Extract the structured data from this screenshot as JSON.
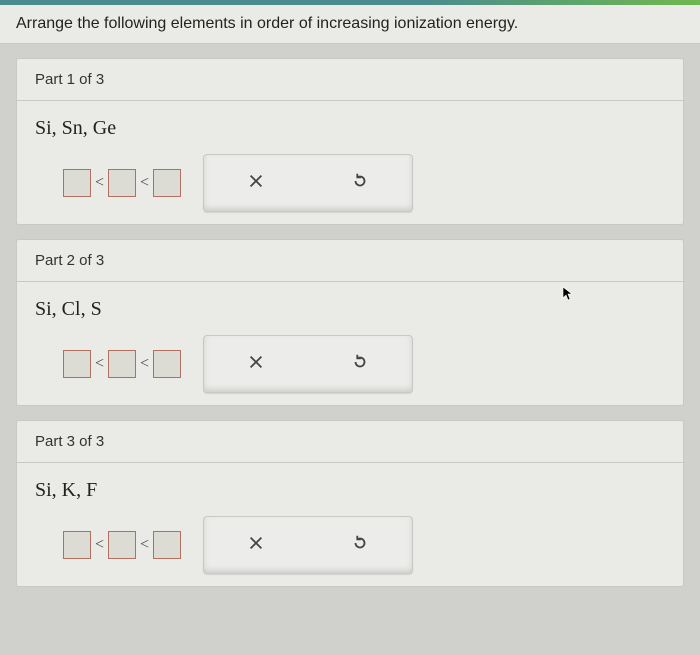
{
  "question": "Arrange the following elements in order of increasing ionization energy.",
  "lt_symbol": "<",
  "parts": [
    {
      "header": "Part 1 of 3",
      "elements": "Si, Sn, Ge"
    },
    {
      "header": "Part 2 of 3",
      "elements": "Si, Cl, S"
    },
    {
      "header": "Part 3 of 3",
      "elements": "Si, K, F"
    }
  ]
}
